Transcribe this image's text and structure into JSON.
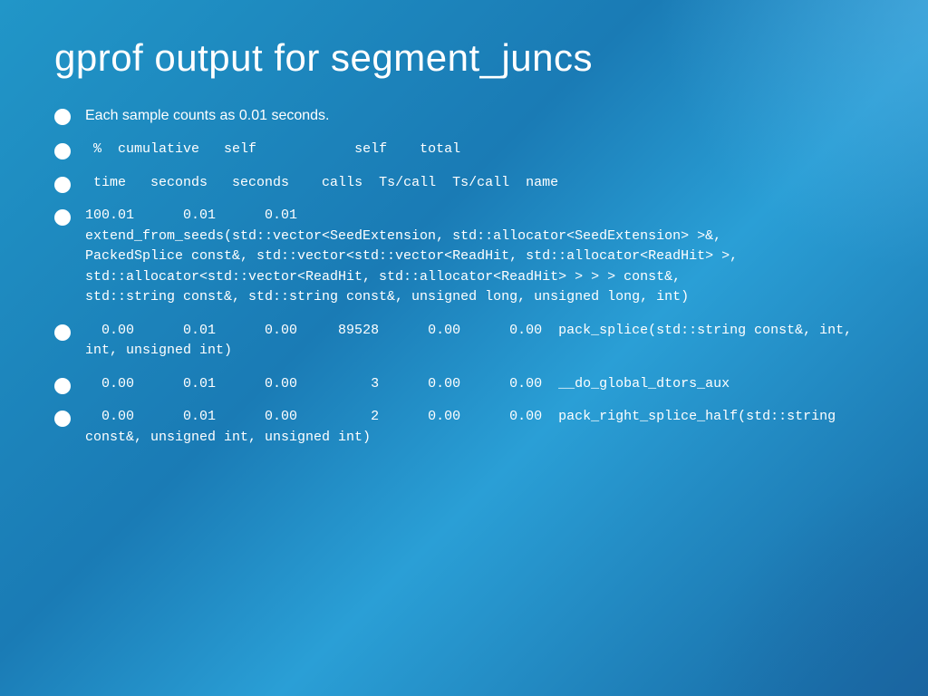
{
  "slide": {
    "title": "gprof output for segment_juncs",
    "bullets": [
      {
        "id": "b1",
        "text": "Each sample counts as 0.01 seconds.",
        "monospace": false
      },
      {
        "id": "b2",
        "text": " %  cumulative   self            self    total",
        "monospace": true
      },
      {
        "id": "b3",
        "text": " time   seconds   seconds    calls  Ts/call  Ts/call  name",
        "monospace": true
      },
      {
        "id": "b4",
        "text": "100.01      0.01      0.01\nextend_from_seeds(std::vector<SeedExtension, std::allocator<SeedExtension> >&,\nPackedSplice const&, std::vector<std::vector<ReadHit, std::allocator<ReadHit> >,\nstd::allocator<std::vector<ReadHit, std::allocator<ReadHit> > > > const&,\nstd::string const&, std::string const&, unsigned long, unsigned long, int)",
        "monospace": true
      },
      {
        "id": "b5",
        "text": "  0.00      0.01      0.00     89528      0.00      0.00  pack_splice(std::string const&, int,\nint, unsigned int)",
        "monospace": true
      },
      {
        "id": "b6",
        "text": "  0.00      0.01      0.00         3      0.00      0.00  __do_global_dtors_aux",
        "monospace": true
      },
      {
        "id": "b7",
        "text": "  0.00      0.01      0.00         2      0.00      0.00  pack_right_splice_half(std::string\nconst&, unsigned int, unsigned int)",
        "monospace": true
      }
    ]
  }
}
